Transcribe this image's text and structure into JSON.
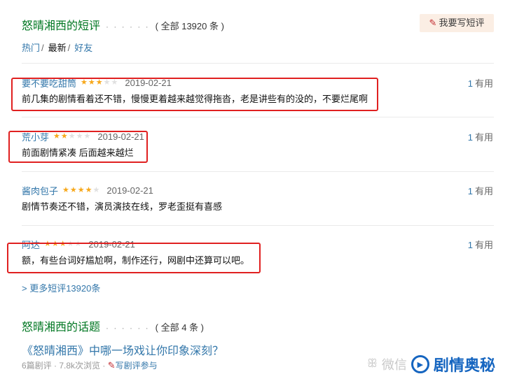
{
  "short_reviews": {
    "title": "怒晴湘西的短评",
    "dots": "· · · · · ·",
    "count_label": "( 全部 13920 条 )",
    "write_button": "我要写短评",
    "tabs": [
      {
        "label": "热门",
        "sep": "/"
      },
      {
        "label": "最新",
        "sep": "/"
      },
      {
        "label": "好友",
        "sep": ""
      }
    ],
    "comments": [
      {
        "user": "要不要吃甜筒",
        "rating": 3,
        "date": "2019-02-21",
        "text": "前几集的剧情看着还不错，慢慢更着越来越觉得拖沓，老是讲些有的没的，不要烂尾啊",
        "useful_count": "1",
        "useful_label": "有用"
      },
      {
        "user": "荒小芽",
        "rating": 2,
        "date": "2019-02-21",
        "text": "前面剧情紧凑 后面越来越烂",
        "useful_count": "1",
        "useful_label": "有用"
      },
      {
        "user": "酱肉包子",
        "rating": 4,
        "date": "2019-02-21",
        "text": "剧情节奏还不错，演员演技在线，罗老歪挺有喜感",
        "useful_count": "1",
        "useful_label": "有用"
      },
      {
        "user": "阿达",
        "rating": 3,
        "date": "2019-02-21",
        "text": "额，有些台词好尴尬啊，制作还行，网剧中还算可以吧。",
        "useful_count": "1",
        "useful_label": "有用"
      }
    ],
    "more_link": "> 更多短评13920条"
  },
  "topics": {
    "title": "怒晴湘西的话题",
    "dots": "· · · · · ·",
    "count_label": "( 全部 4 条 )",
    "topic_title": "《怒晴湘西》中哪一场戏让你印象深刻？",
    "meta": "6篇剧评 · 7.8k次浏览 ·",
    "write_link": "写剧评参与"
  },
  "watermark": {
    "wechat": "微信",
    "brand": "剧情奥秘"
  },
  "colors": {
    "title_green": "#007722",
    "link_blue": "#3377aa",
    "star_gold": "#f7a81b",
    "highlight_red": "#e02020"
  }
}
